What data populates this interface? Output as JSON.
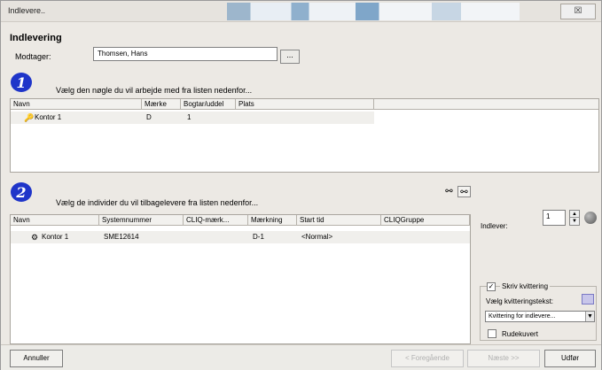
{
  "window": {
    "title": "Indlevere..",
    "close_glyph": "☒"
  },
  "heading": "Indlevering",
  "recipient": {
    "label": "Modtager:",
    "value": "Thomsen, Hans",
    "browse_label": "..."
  },
  "step1": {
    "number": "1",
    "text": "Vælg den nøgle du vil arbejde med fra listen nedenfor...",
    "columns": [
      "Navn",
      "Mærke",
      "Bogtar/uddel",
      "Plats"
    ],
    "rows": [
      {
        "name": "Kontor 1",
        "maerke": "D",
        "bogtar": "1",
        "plats": ""
      }
    ]
  },
  "step2": {
    "number": "2",
    "text": "Vælg de individer du vil tilbagelevere fra listen nedenfor...",
    "columns": [
      "Navn",
      "Systemnummer",
      "CLIQ-mærk...",
      "Mærkning",
      "Start tid",
      "CLIQGruppe"
    ],
    "rows": [
      {
        "name": "Kontor 1",
        "system": "SME12614",
        "cliq": "",
        "maerkning": "D-1",
        "start": "<Normal>",
        "gruppe": ""
      }
    ]
  },
  "indlever": {
    "label": "Indlever:",
    "value": "1"
  },
  "receipt": {
    "print_label": "Skriv kvittering",
    "print_checked": true,
    "select_text_label": "Vælg kvitteringstekst:",
    "selected_text": "Kvittering for indlevere...",
    "rudekuvert_label": "Rudekuvert",
    "rudekuvert_checked": false
  },
  "buttons": {
    "cancel": "Annuller",
    "back": "< Foregående",
    "next": "Næste >>",
    "finish": "Udfør"
  },
  "colors": {
    "step_icon": "#1f35c9",
    "title_deco": "#7fa6c9"
  }
}
